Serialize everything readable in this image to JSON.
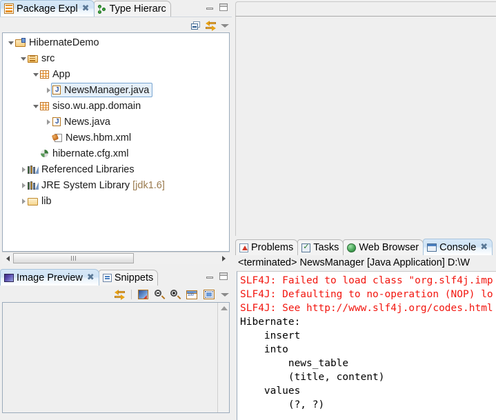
{
  "left_top_panel": {
    "tabs": [
      {
        "label": "Package Expl",
        "icon": "package-explorer-icon",
        "active": true,
        "closable": true
      },
      {
        "label": "Type Hierarc",
        "icon": "type-hierarchy-icon",
        "active": false,
        "closable": false
      }
    ],
    "window_buttons": {
      "minimize": "minimize-icon",
      "maximize": "maximize-icon"
    },
    "toolbar": [
      {
        "name": "collapse-all-icon"
      },
      {
        "name": "link-with-editor-icon"
      },
      {
        "name": "view-menu-icon"
      }
    ],
    "tree": [
      {
        "label": "HibernateDemo",
        "icon": "java-project-icon",
        "indent": 0,
        "arrow": "open"
      },
      {
        "label": "src",
        "icon": "source-folder-icon",
        "indent": 1,
        "arrow": "open"
      },
      {
        "label": "App",
        "icon": "package-icon",
        "indent": 2,
        "arrow": "open"
      },
      {
        "label": "NewsManager.java",
        "icon": "java-file-icon",
        "indent": 3,
        "arrow": "closed",
        "selected": true
      },
      {
        "label": "siso.wu.app.domain",
        "icon": "package-icon",
        "indent": 2,
        "arrow": "open"
      },
      {
        "label": "News.java",
        "icon": "java-file-icon",
        "indent": 3,
        "arrow": "closed"
      },
      {
        "label": "News.hbm.xml",
        "icon": "hibernate-mapping-icon",
        "indent": 3,
        "arrow": "none"
      },
      {
        "label": "hibernate.cfg.xml",
        "icon": "hibernate-config-icon",
        "indent": 2,
        "arrow": "none"
      },
      {
        "label": "Referenced Libraries",
        "icon": "library-icon",
        "indent": 1,
        "arrow": "closed"
      },
      {
        "label": "JRE System Library",
        "suffix": "[jdk1.6]",
        "icon": "library-icon",
        "indent": 1,
        "arrow": "closed"
      },
      {
        "label": "lib",
        "icon": "folder-icon",
        "indent": 1,
        "arrow": "closed"
      }
    ]
  },
  "left_bottom_panel": {
    "tabs": [
      {
        "label": "Image Preview",
        "icon": "image-preview-icon",
        "active": true,
        "closable": true
      },
      {
        "label": "Snippets",
        "icon": "snippets-icon",
        "active": false,
        "closable": false
      }
    ],
    "window_buttons": {
      "minimize": "minimize-icon",
      "maximize": "maximize-icon"
    },
    "toolbar": [
      {
        "name": "link-with-editor-icon"
      },
      {
        "name": "image-tool-icon"
      },
      {
        "name": "zoom-out-icon"
      },
      {
        "name": "zoom-in-icon"
      },
      {
        "name": "actual-size-100-icon"
      },
      {
        "name": "fit-to-window-icon"
      },
      {
        "name": "view-menu-icon"
      }
    ]
  },
  "console_panel": {
    "tabs": [
      {
        "label": "Problems",
        "icon": "problems-icon",
        "active": false
      },
      {
        "label": "Tasks",
        "icon": "tasks-icon",
        "active": false
      },
      {
        "label": "Web Browser",
        "icon": "web-browser-icon",
        "active": false
      },
      {
        "label": "Console",
        "icon": "console-icon",
        "active": true,
        "closable": true
      }
    ],
    "launch_header": "<terminated> NewsManager [Java Application] D:\\W",
    "output_lines": [
      {
        "text": "SLF4J: Failed to load class \"org.slf4j.imp",
        "error": true
      },
      {
        "text": "SLF4J: Defaulting to no-operation (NOP) lo",
        "error": true
      },
      {
        "text": "SLF4J: See http://www.slf4j.org/codes.html",
        "error": true
      },
      {
        "text": "Hibernate: ",
        "error": false
      },
      {
        "text": "    insert ",
        "error": false
      },
      {
        "text": "    into",
        "error": false
      },
      {
        "text": "        news_table",
        "error": false
      },
      {
        "text": "        (title, content) ",
        "error": false
      },
      {
        "text": "    values",
        "error": false
      },
      {
        "text": "        (?, ?)",
        "error": false
      }
    ]
  },
  "colors": {
    "error_text": "#f2160f",
    "tab_active": "#cfe3f5",
    "selection_fill": "#e4eff9",
    "selection_border": "#7aa6d2",
    "panel_bg": "#efefef"
  }
}
